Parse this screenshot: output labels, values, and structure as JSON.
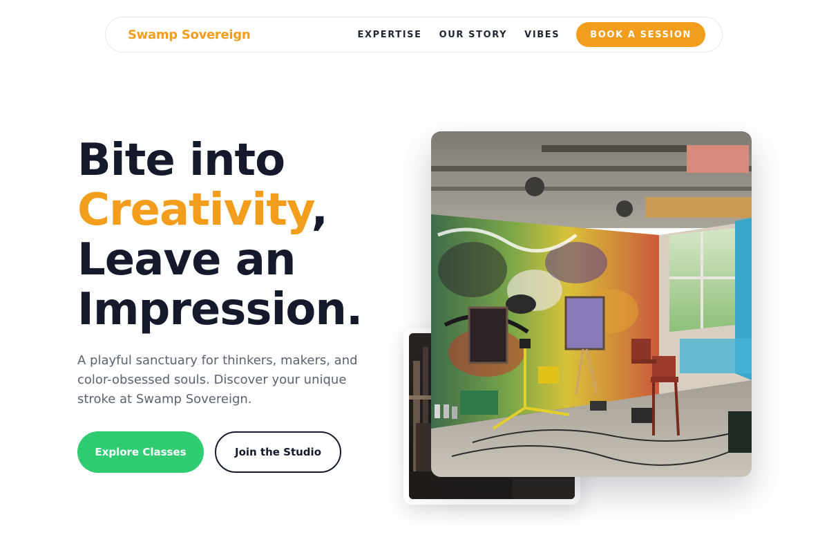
{
  "nav": {
    "brand": "Swamp Sovereign",
    "links": [
      "EXPERTISE",
      "OUR STORY",
      "VIBES"
    ],
    "cta": "BOOK A SESSION"
  },
  "hero": {
    "title_line1": "Bite into",
    "title_accent": "Creativity",
    "title_comma": ",",
    "title_line3": "Leave an",
    "title_line4": "Impression.",
    "subtitle": "A playful sanctuary for thinkers, makers, and color-obsessed souls. Discover your unique stroke at Swamp Sovereign.",
    "primary_button": "Explore Classes",
    "secondary_button": "Join the Studio"
  },
  "colors": {
    "accent": "#f29d1b",
    "primary_button": "#2fcc71",
    "heading": "#141a2c",
    "body_text": "#5b6270"
  }
}
